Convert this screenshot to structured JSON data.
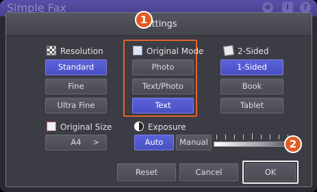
{
  "app": {
    "title": "Simple Fax"
  },
  "dialog": {
    "title": "Settings"
  },
  "resolution": {
    "label": "Resolution",
    "options": [
      "Standard",
      "Fine",
      "Ultra Fine"
    ],
    "selected": "Standard"
  },
  "original_mode": {
    "label": "Original Mode",
    "options": [
      "Photo",
      "Text/Photo",
      "Text"
    ],
    "selected": "Text"
  },
  "two_sided": {
    "label": "2-Sided",
    "options": [
      "1-Sided",
      "Book",
      "Tablet"
    ],
    "selected": "1-Sided"
  },
  "original_size": {
    "label": "Original Size",
    "value": "A4",
    "arrow": ">"
  },
  "exposure": {
    "label": "Exposure",
    "auto_label": "Auto",
    "manual_label": "Manual",
    "selected": "Auto"
  },
  "footer": {
    "reset_label": "Reset",
    "cancel_label": "Cancel",
    "ok_label": "OK"
  },
  "annotations": {
    "badge1": "1",
    "badge2": "2",
    "color": "#df5d24"
  },
  "colors": {
    "selected": "#4a50c4",
    "header": "#46408a"
  }
}
